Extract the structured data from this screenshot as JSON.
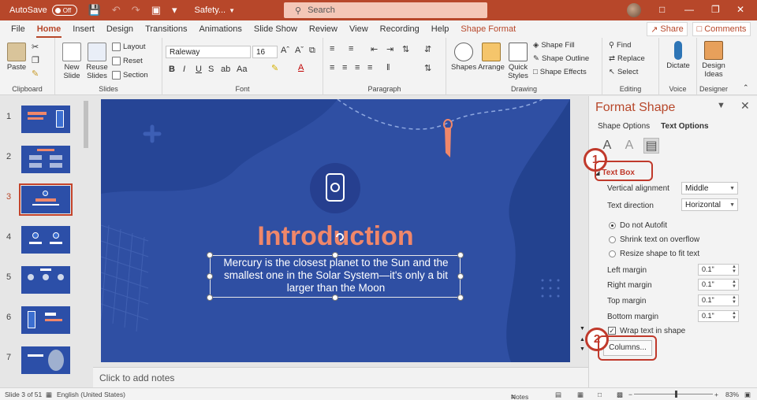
{
  "titlebar": {
    "autosave_label": "AutoSave",
    "autosave_state": "Off",
    "doc_title": "Safety...",
    "search_placeholder": "Search",
    "icons": [
      "save-icon",
      "undo-icon",
      "redo-icon",
      "present-icon",
      "more-icon"
    ]
  },
  "ribbon_tabs": [
    "File",
    "Home",
    "Insert",
    "Design",
    "Transitions",
    "Animations",
    "Slide Show",
    "Review",
    "View",
    "Recording",
    "Help",
    "Shape Format"
  ],
  "active_tab": "Home",
  "share_label": "Share",
  "comments_label": "Comments",
  "ribbon": {
    "clipboard": {
      "label": "Clipboard",
      "paste": "Paste"
    },
    "slides": {
      "label": "Slides",
      "new_slide": "New Slide",
      "reuse_slides": "Reuse Slides",
      "layout": "Layout",
      "reset": "Reset",
      "section": "Section"
    },
    "font": {
      "label": "Font",
      "font_name": "Raleway",
      "font_size": "16"
    },
    "paragraph": {
      "label": "Paragraph"
    },
    "drawing": {
      "label": "Drawing",
      "shapes": "Shapes",
      "arrange": "Arrange",
      "quick_styles": "Quick Styles",
      "shape_fill": "Shape Fill",
      "shape_outline": "Shape Outline",
      "shape_effects": "Shape Effects"
    },
    "editing": {
      "label": "Editing",
      "find": "Find",
      "replace": "Replace",
      "select": "Select"
    },
    "voice": {
      "label": "Voice",
      "dictate": "Dictate"
    },
    "designer": {
      "label": "Designer",
      "design_ideas": "Design Ideas"
    }
  },
  "thumbnails": [
    {
      "num": "1",
      "selected": false
    },
    {
      "num": "2",
      "selected": false
    },
    {
      "num": "3",
      "selected": true
    },
    {
      "num": "4",
      "selected": false
    },
    {
      "num": "5",
      "selected": false
    },
    {
      "num": "6",
      "selected": false
    },
    {
      "num": "7",
      "selected": false
    }
  ],
  "slide": {
    "title": "Introduction",
    "body": "Mercury is the closest planet to the Sun and the smallest one in the Solar System—it's only a bit larger than the Moon",
    "bg_color": "#2f4fa3",
    "title_color": "#f0876a"
  },
  "notes_placeholder": "Click to add notes",
  "format_pane": {
    "title": "Format Shape",
    "tab_shape": "Shape Options",
    "tab_text": "Text Options",
    "section": "Text Box",
    "vertical_alignment_label": "Vertical alignment",
    "vertical_alignment_value": "Middle",
    "text_direction_label": "Text direction",
    "text_direction_value": "Horizontal",
    "autofit": [
      "Do not Autofit",
      "Shrink text on overflow",
      "Resize shape to fit text"
    ],
    "margins": [
      {
        "label": "Left margin",
        "value": "0.1\""
      },
      {
        "label": "Right margin",
        "value": "0.1\""
      },
      {
        "label": "Top margin",
        "value": "0.1\""
      },
      {
        "label": "Bottom margin",
        "value": "0.1\""
      }
    ],
    "wrap_text": "Wrap text in shape",
    "columns_button": "Columns..."
  },
  "callouts": [
    "1",
    "2"
  ],
  "status": {
    "slide_info": "Slide 3 of 51",
    "language": "English (United States)",
    "notes": "Notes",
    "zoom": "83%"
  },
  "colors": {
    "accent": "#b7472a",
    "callout": "#c0392b"
  }
}
